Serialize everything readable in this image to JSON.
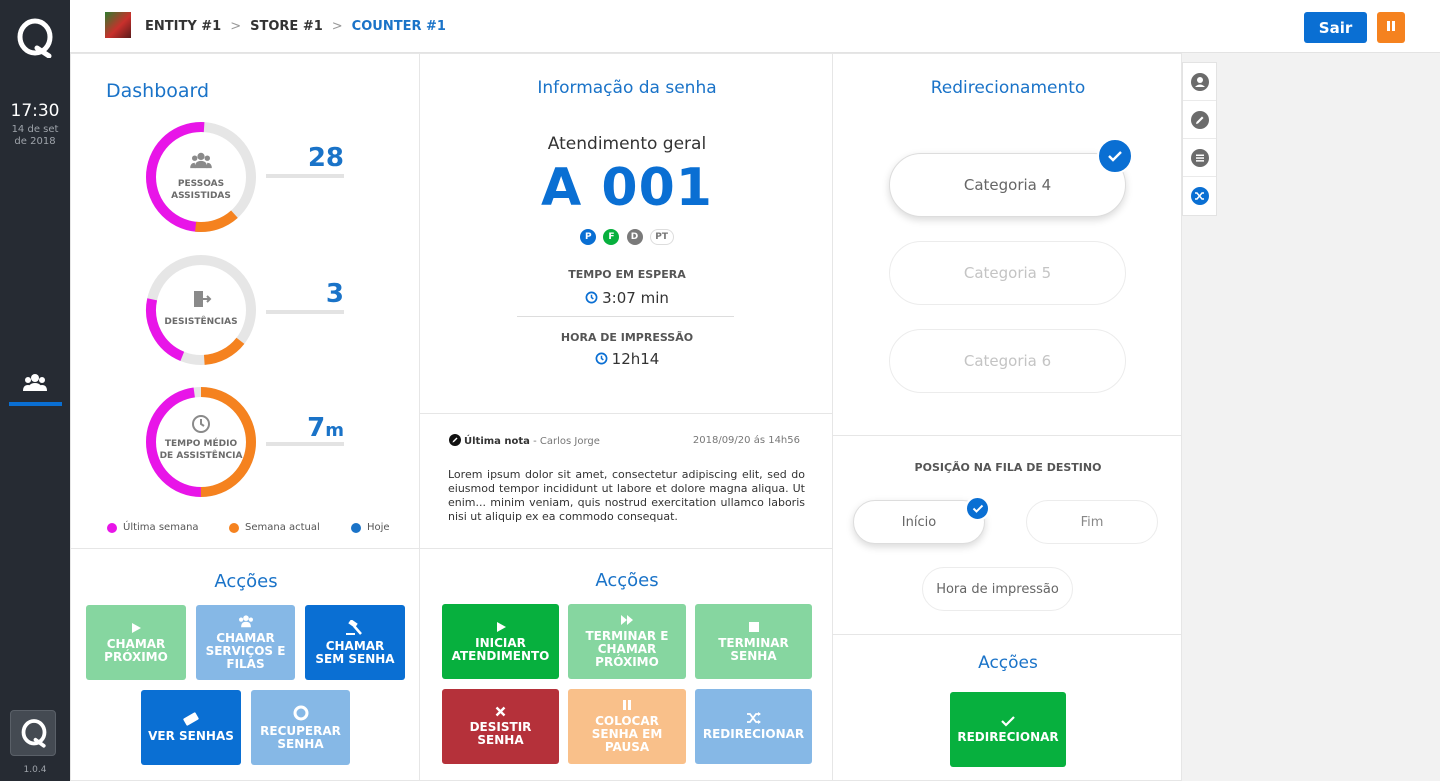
{
  "rail": {
    "time": "17:30",
    "date_line1": "14 de set",
    "date_line2": "de 2018",
    "version": "1.0.4"
  },
  "breadcrumb": {
    "entity": "ENTITY #1",
    "store": "STORE #1",
    "counter": "COUNTER #1",
    "separator": ">"
  },
  "header": {
    "exit_label": "Sair"
  },
  "dashboard": {
    "title": "Dashboard",
    "stats": [
      {
        "label_l1": "PESSOAS",
        "label_l2": "ASSISTIDAS",
        "value": "28",
        "unit": ""
      },
      {
        "label_l1": "DESISTÊNCIAS",
        "label_l2": "",
        "value": "3",
        "unit": ""
      },
      {
        "label_l1": "TEMPO MÉDIO",
        "label_l2": "DE ASSISTÊNCIA",
        "value": "7",
        "unit": "m"
      }
    ],
    "legend": [
      "Última semana",
      "Semana actual",
      "Hoje"
    ],
    "colors": {
      "last_week": "#e815e8",
      "this_week": "#f5821f",
      "today": "#1a73c8"
    }
  },
  "actions_left": {
    "title": "Acções",
    "buttons": [
      {
        "label": "CHAMAR PRÓXIMO",
        "icon": "play-icon",
        "color": "#86d6a0"
      },
      {
        "label": "CHAMAR SERVIÇOS E FILAS",
        "icon": "people-icon",
        "color": "#86b8e6"
      },
      {
        "label": "CHAMAR SEM SENHA",
        "icon": "gavel-icon",
        "color": "#0a6fd3"
      },
      {
        "label": "VER SENHAS",
        "icon": "ticket-icon",
        "color": "#0a6fd3"
      },
      {
        "label": "RECUPERAR SENHA",
        "icon": "lifebuoy-icon",
        "color": "#86b8e6"
      }
    ]
  },
  "ticket": {
    "title": "Informação da senha",
    "category": "Atendimento geral",
    "number": "A 001",
    "tags": [
      "P",
      "F",
      "D",
      "PT"
    ],
    "wait_label": "TEMPO EM ESPERA",
    "wait_value": "3:07 min",
    "print_label": "HORA DE IMPRESSÃO",
    "print_value": "12h14"
  },
  "note": {
    "title": "Última nota",
    "author": " - Carlos Jorge",
    "date": "2018/09/20 ás 14h56",
    "text": "Lorem ipsum dolor sit amet, consectetur adipiscing elit, sed do eiusmod tempor incididunt ut labore et dolore magna aliqua. Ut enim... minim veniam, quis nostrud exercitation ullamco laboris nisi ut aliquip ex ea commodo consequat."
  },
  "actions_mid": {
    "title": "Acções",
    "buttons": [
      {
        "label": "INICIAR ATENDIMENTO",
        "icon": "play-icon",
        "color": "#07b03e"
      },
      {
        "label": "TERMINAR E CHAMAR PRÓXIMO",
        "icon": "fast-forward-icon",
        "color": "#86d6a0"
      },
      {
        "label": "TERMINAR SENHA",
        "icon": "stop-icon",
        "color": "#86d6a0"
      },
      {
        "label": "DESISTIR SENHA",
        "icon": "close-icon",
        "color": "#b5313a"
      },
      {
        "label": "COLOCAR SENHA EM PAUSA",
        "icon": "pause-icon",
        "color": "#f9c08a"
      },
      {
        "label": "REDIRECIONAR",
        "icon": "shuffle-icon",
        "color": "#86b8e6"
      }
    ]
  },
  "redirect": {
    "title": "Redirecionamento",
    "categories": [
      "Categoria 4",
      "Categoria 5",
      "Categoria 6"
    ],
    "position_title": "POSIÇÃO NA FILA DE DESTINO",
    "positions": [
      "Início",
      "Fim",
      "Hora de impressão"
    ],
    "actions_title": "Acções",
    "redirect_button": "REDIRECIONAR",
    "redirect_color": "#07b03e"
  }
}
